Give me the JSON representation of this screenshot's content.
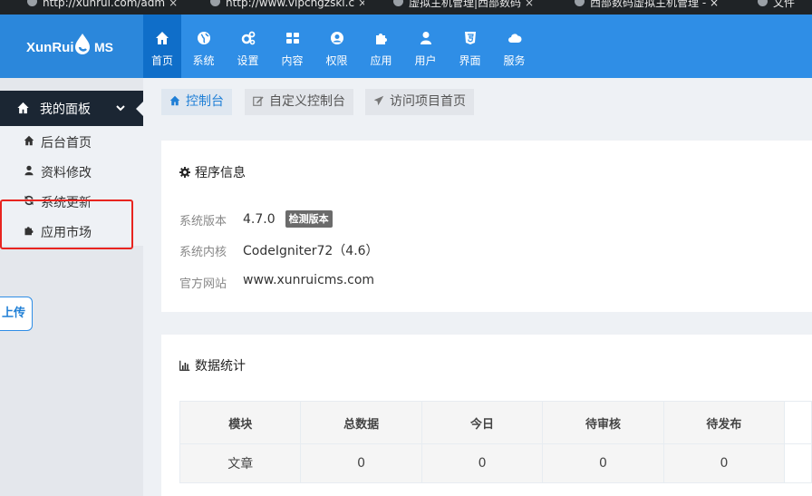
{
  "browser": {
    "tabs": [
      {
        "title": "http://xunrui.com/adm"
      },
      {
        "title": "http://www.vipcngzski.c"
      },
      {
        "title": "虚拟主机管理|西部数码"
      },
      {
        "title": "西部数码虚拟主机管理 - ×"
      },
      {
        "title": "文件"
      }
    ]
  },
  "logo": {
    "text_left": "XunRui",
    "text_right": "MS"
  },
  "topnav": [
    {
      "label": "首页",
      "icon": "home-icon"
    },
    {
      "label": "系统",
      "icon": "globe-icon"
    },
    {
      "label": "设置",
      "icon": "gears-icon"
    },
    {
      "label": "内容",
      "icon": "grid-icon"
    },
    {
      "label": "权限",
      "icon": "user-circle-icon"
    },
    {
      "label": "应用",
      "icon": "puzzle-icon"
    },
    {
      "label": "用户",
      "icon": "user-icon"
    },
    {
      "label": "界面",
      "icon": "html5-icon"
    },
    {
      "label": "服务",
      "icon": "cloud-icon"
    }
  ],
  "sidebar": {
    "header": "我的面板",
    "items": [
      {
        "label": "后台首页",
        "icon": "home-icon"
      },
      {
        "label": "资料修改",
        "icon": "user-icon"
      },
      {
        "label": "系统更新",
        "icon": "refresh-icon"
      },
      {
        "label": "应用市场",
        "icon": "puzzle-icon"
      }
    ],
    "upload_label": "上传"
  },
  "breadcrumbs": [
    {
      "label": "控制台",
      "icon": "home-icon"
    },
    {
      "label": "自定义控制台",
      "icon": "edit-icon"
    },
    {
      "label": "访问项目首页",
      "icon": "send-icon"
    }
  ],
  "info_panel": {
    "title": "程序信息",
    "rows": [
      {
        "label": "系统版本",
        "value": "4.7.0",
        "badge": "检测版本"
      },
      {
        "label": "系统内核",
        "value": "CodeIgniter72（4.6）"
      },
      {
        "label": "官方网站",
        "value": "www.xunruicms.com"
      }
    ]
  },
  "stats_panel": {
    "title": "数据统计",
    "columns": [
      "模块",
      "总数据",
      "今日",
      "待审核",
      "待发布"
    ],
    "rows": [
      [
        "文章",
        "0",
        "0",
        "0",
        "0"
      ]
    ]
  },
  "colors": {
    "header_blue": "#2f8ee6",
    "active_nav": "#0f6ec9",
    "sidebar_dark": "#1b2633",
    "highlight_red": "#e8241f"
  }
}
